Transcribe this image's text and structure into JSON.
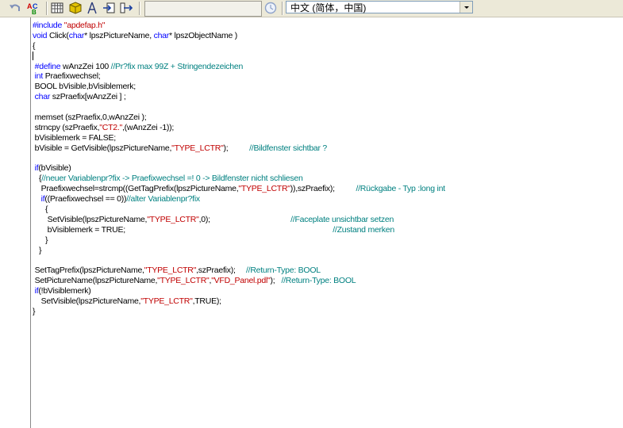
{
  "toolbar": {
    "search_value": "",
    "language_select": "中文 (简体，中国)"
  },
  "code_lines": [
    [
      {
        "t": "#include ",
        "c": "kw"
      },
      {
        "t": "\"apdefap.h\"",
        "c": "str"
      }
    ],
    [
      {
        "t": "void ",
        "c": "kw"
      },
      {
        "t": "Click(",
        "c": ""
      },
      {
        "t": "char",
        "c": "kw"
      },
      {
        "t": "* lpszPictureName, ",
        "c": ""
      },
      {
        "t": "char",
        "c": "kw"
      },
      {
        "t": "* lpszObjectName )",
        "c": ""
      }
    ],
    [
      {
        "t": "{",
        "c": ""
      }
    ],
    [
      {
        "t": "",
        "c": "caret"
      }
    ],
    [
      {
        "t": " #define ",
        "c": "kw"
      },
      {
        "t": "wAnzZei 100 ",
        "c": ""
      },
      {
        "t": "//Pr?fix max 99Z + Stringendezeichen",
        "c": "cm"
      }
    ],
    [
      {
        "t": " int ",
        "c": "kw"
      },
      {
        "t": "Praefixwechsel;",
        "c": ""
      }
    ],
    [
      {
        "t": " BOOL bVisible,bVisiblemerk;",
        "c": ""
      }
    ],
    [
      {
        "t": " char ",
        "c": "kw"
      },
      {
        "t": "szPraefix[wAnzZei ] ;",
        "c": ""
      }
    ],
    [
      {
        "t": "",
        "c": ""
      }
    ],
    [
      {
        "t": " memset (szPraefix,0,wAnzZei );",
        "c": ""
      }
    ],
    [
      {
        "t": " strncpy (szPraefix,",
        "c": ""
      },
      {
        "t": "\"CT2.\"",
        "c": "str"
      },
      {
        "t": ",(wAnzZei -1));",
        "c": ""
      }
    ],
    [
      {
        "t": " bVisiblemerk = FALSE;",
        "c": ""
      }
    ],
    [
      {
        "t": " bVisible = GetVisible(lpszPictureName,",
        "c": ""
      },
      {
        "t": "\"TYPE_LCTR\"",
        "c": "str"
      },
      {
        "t": ");          ",
        "c": ""
      },
      {
        "t": "//Bildfenster sichtbar ?",
        "c": "cm"
      }
    ],
    [
      {
        "t": "",
        "c": ""
      }
    ],
    [
      {
        "t": " if",
        "c": "kw"
      },
      {
        "t": "(bVisible)",
        "c": ""
      }
    ],
    [
      {
        "t": "   {",
        "c": ""
      },
      {
        "t": "//neuer Variablenpr?fix -> Praefixwechsel =! 0 -> Bildfenster nicht schliesen",
        "c": "cm"
      }
    ],
    [
      {
        "t": "    Praefixwechsel=strcmp((GetTagPrefix(lpszPictureName,",
        "c": ""
      },
      {
        "t": "\"TYPE_LCTR\"",
        "c": "str"
      },
      {
        "t": ")),szPraefix);          ",
        "c": ""
      },
      {
        "t": "//Rückgabe - Typ :long int",
        "c": "cm"
      }
    ],
    [
      {
        "t": "    if",
        "c": "kw"
      },
      {
        "t": "((Praefixwechsel == 0))",
        "c": ""
      },
      {
        "t": "//alter Variablenpr?fix",
        "c": "cm"
      }
    ],
    [
      {
        "t": "      {",
        "c": ""
      }
    ],
    [
      {
        "t": "       SetVisible(lpszPictureName,",
        "c": ""
      },
      {
        "t": "\"TYPE_LCTR\"",
        "c": "str"
      },
      {
        "t": ",0);                                      ",
        "c": ""
      },
      {
        "t": "//Faceplate unsichtbar setzen",
        "c": "cm"
      }
    ],
    [
      {
        "t": "       bVisiblemerk = TRUE;                                                                                                  ",
        "c": ""
      },
      {
        "t": "//Zustand merken",
        "c": "cm"
      }
    ],
    [
      {
        "t": "      }",
        "c": ""
      }
    ],
    [
      {
        "t": "   }",
        "c": ""
      }
    ],
    [
      {
        "t": "",
        "c": ""
      }
    ],
    [
      {
        "t": " SetTagPrefix(lpszPictureName,",
        "c": ""
      },
      {
        "t": "\"TYPE_LCTR\"",
        "c": "str"
      },
      {
        "t": ",szPraefix);     ",
        "c": ""
      },
      {
        "t": "//Return-Type: BOOL",
        "c": "cm"
      }
    ],
    [
      {
        "t": " SetPictureName(lpszPictureName,",
        "c": ""
      },
      {
        "t": "\"TYPE_LCTR\"",
        "c": "str"
      },
      {
        "t": ",",
        "c": ""
      },
      {
        "t": "\"VFD_Panel.pdl\"",
        "c": "str"
      },
      {
        "t": ");   ",
        "c": ""
      },
      {
        "t": "//Return-Type: BOOL",
        "c": "cm"
      }
    ],
    [
      {
        "t": " if",
        "c": "kw"
      },
      {
        "t": "(!bVisiblemerk)",
        "c": ""
      }
    ],
    [
      {
        "t": "    SetVisible(lpszPictureName,",
        "c": ""
      },
      {
        "t": "\"TYPE_LCTR\"",
        "c": "str"
      },
      {
        "t": ",TRUE);",
        "c": ""
      }
    ],
    [
      {
        "t": "}",
        "c": ""
      }
    ]
  ]
}
